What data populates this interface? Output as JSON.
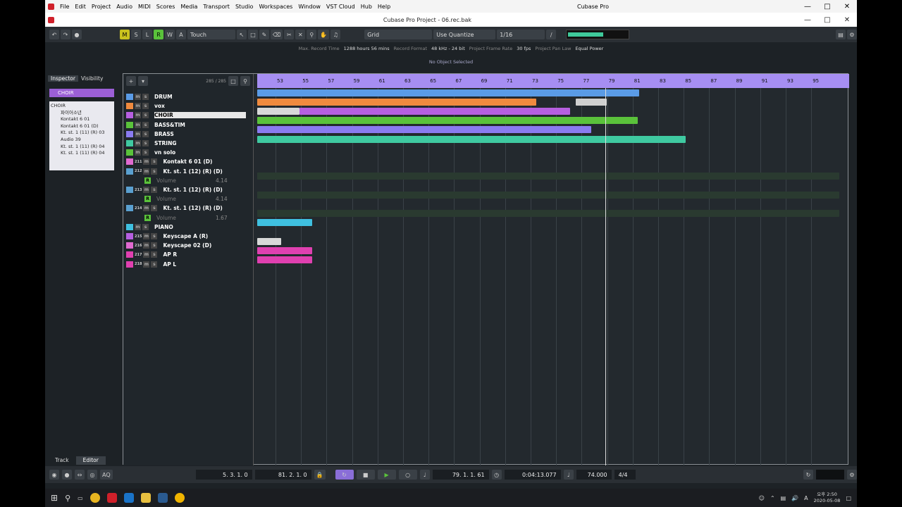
{
  "menu": [
    "File",
    "Edit",
    "Project",
    "Audio",
    "MIDI",
    "Scores",
    "Media",
    "Transport",
    "Studio",
    "Workspaces",
    "Window",
    "VST Cloud",
    "Hub",
    "Help"
  ],
  "app_title": "Cubase Pro",
  "window_title": "Cubase Pro Project - 06.rec.bak",
  "toolbar": {
    "m": "M",
    "s": "S",
    "l": "L",
    "r": "R",
    "w": "W",
    "a": "A",
    "automation_mode": "Touch",
    "grid_type": "Grid",
    "quantize_label": "Use Quantize",
    "quantize_value": "1/16"
  },
  "info_line": [
    {
      "k": "Max. Record Time",
      "v": "1288 hours 56 mins"
    },
    {
      "k": "Record Format",
      "v": "48 kHz - 24 bit"
    },
    {
      "k": "Project Frame Rate",
      "v": "30 fps"
    },
    {
      "k": "Project Pan Law",
      "v": "Equal Power"
    }
  ],
  "status": "No Object Selected",
  "inspector": {
    "tab_inspector": "Inspector",
    "tab_visibility": "Visibility",
    "track_name": "CHOIR",
    "list": [
      "CHOIR",
      "파이어소년",
      "Kontakt 6 01",
      "Kontakt 6 01 (D)",
      "Kt. st. 1 (11) (R) 03",
      "Audio 39",
      "Kt. st. 1 (11) (R) 04",
      "Kt. st. 1 (11) (R) 04"
    ]
  },
  "bottom_tabs": {
    "track": "Track",
    "editor": "Editor"
  },
  "track_count": "285 / 285",
  "tracks": [
    {
      "name": "DRUM",
      "color": "#5a9be6"
    },
    {
      "name": "vox",
      "color": "#f08a3e"
    },
    {
      "name": "CHOIR",
      "color": "#b65fe0"
    },
    {
      "name": "BASS&TIM",
      "color": "#5ac23b"
    },
    {
      "name": "BRASS",
      "color": "#8a7bf0"
    },
    {
      "name": "STRING",
      "color": "#3fc9a1"
    },
    {
      "name": "vn solo",
      "color": "#5ac23b"
    },
    {
      "name": "Kontakt 6 01 (D)",
      "color": "#e06ad0",
      "num": "211"
    },
    {
      "name": "Kt. st. 1 (12) (R) (D)",
      "color": "#5aa0d0",
      "num": "212"
    },
    {
      "name": "Volume",
      "color": "#2a3a30",
      "val": "4.14"
    },
    {
      "name": "Kt. st. 1 (12) (R) (D)",
      "color": "#5aa0d0",
      "num": "213"
    },
    {
      "name": "Volume",
      "color": "#2a3a30",
      "val": "4.14"
    },
    {
      "name": "Kt. st. 1 (12) (R) (D)",
      "color": "#5aa0d0",
      "num": "214"
    },
    {
      "name": "Volume",
      "color": "#2a3a30",
      "val": "1.67"
    },
    {
      "name": "PIANO",
      "color": "#3fc0e0"
    },
    {
      "name": "Keyscape A (R)",
      "color": "#b65fe0",
      "num": "215"
    },
    {
      "name": "Keyscape 02 (D)",
      "color": "#e06ad0",
      "num": "216"
    },
    {
      "name": "AP R",
      "color": "#e040b0",
      "num": "217"
    },
    {
      "name": "AP L",
      "color": "#e040b0",
      "num": "218"
    }
  ],
  "ruler": [
    "53",
    "55",
    "57",
    "59",
    "61",
    "63",
    "65",
    "67",
    "69",
    "71",
    "73",
    "75",
    "77",
    "79",
    "81",
    "83",
    "85",
    "87",
    "89",
    "91",
    "93",
    "95"
  ],
  "transport": {
    "left_locator": "5. 3. 1.  0",
    "right_locator": "81. 2. 1.  0",
    "position": "79. 1. 1. 61",
    "time": "0:04:13.077",
    "tempo": "74.000",
    "signature": "4/4",
    "aq": "AQ"
  },
  "taskbar": {
    "time": "오후 2:50",
    "date": "2020-05-08",
    "lang": "A"
  }
}
